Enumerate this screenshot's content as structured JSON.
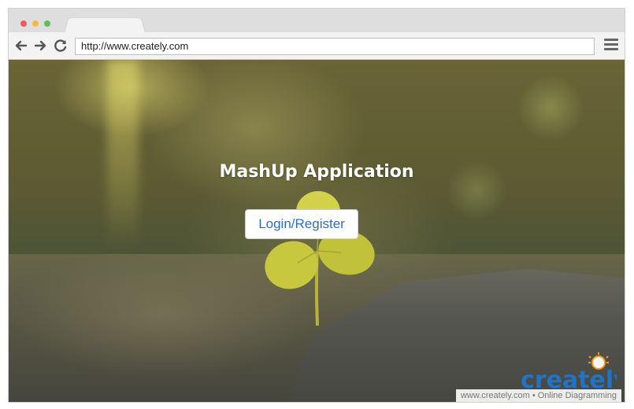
{
  "browser": {
    "url": "http://www.creately.com",
    "window_controls": [
      "close",
      "minimize",
      "maximize"
    ],
    "nav_icons": [
      "back-arrow-icon",
      "forward-arrow-icon",
      "reload-icon"
    ],
    "menu_icon": "hamburger-menu-icon"
  },
  "page": {
    "title": "MashUp Application",
    "login_button_label": "Login/Register"
  },
  "watermark": {
    "logo_text": "creately",
    "caption": "www.creately.com • Online Diagramming"
  },
  "colors": {
    "accent": "#2b6fc4",
    "close_dot": "#ee5a5a",
    "minimize_dot": "#f4bc3b",
    "maximize_dot": "#5ac05a",
    "logo_blue": "#1f74c7",
    "logo_orange": "#f39a1a"
  }
}
